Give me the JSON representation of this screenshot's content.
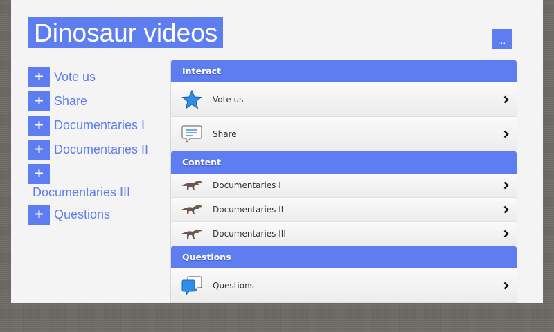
{
  "header": {
    "title": "Dinosaur videos",
    "menu_label": "..."
  },
  "sidebar": {
    "items": [
      {
        "label": "Vote us"
      },
      {
        "label": "Share"
      },
      {
        "label": "Documentaries I"
      },
      {
        "label": "Documentaries II"
      },
      {
        "label": "Documentaries III"
      },
      {
        "label": "Questions"
      }
    ],
    "plus_symbol": "+"
  },
  "panel": {
    "sections": [
      {
        "title": "Interact",
        "items": [
          {
            "label": "Vote us",
            "icon": "star-icon"
          },
          {
            "label": "Share",
            "icon": "speech-bubble-icon"
          }
        ]
      },
      {
        "title": "Content",
        "items": [
          {
            "label": "Documentaries I",
            "icon": "dinosaur-icon"
          },
          {
            "label": "Documentaries II",
            "icon": "dinosaur-icon"
          },
          {
            "label": "Documentaries III",
            "icon": "dinosaur-icon"
          }
        ]
      },
      {
        "title": "Questions",
        "items": [
          {
            "label": "Questions",
            "icon": "chat-bubbles-icon"
          }
        ]
      }
    ]
  },
  "colors": {
    "accent": "#5e7df0",
    "page_bg": "#f4f4f4",
    "outer_bg": "#6e6a66"
  }
}
